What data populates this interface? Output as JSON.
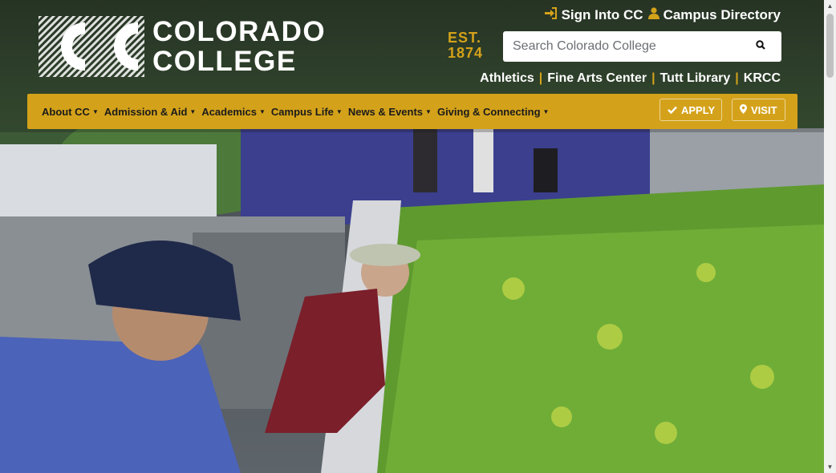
{
  "brand": {
    "name_line1": "COLORADO",
    "name_line2": "COLLEGE",
    "est_line1": "EST.",
    "est_line2": "1874"
  },
  "utility": {
    "sign_in": {
      "label": "Sign Into CC",
      "icon": "sign-in-icon"
    },
    "directory": {
      "label": "Campus Directory",
      "icon": "user-icon"
    }
  },
  "search": {
    "placeholder": "Search Colorado College",
    "value": "",
    "icon": "search-icon"
  },
  "quick_links": [
    "Athletics",
    "Fine Arts Center",
    "Tutt Library",
    "KRCC"
  ],
  "quick_links_separator": "|",
  "nav": {
    "items": [
      "About CC",
      "Admission & Aid",
      "Academics",
      "Campus Life",
      "News & Events",
      "Giving & Connecting"
    ],
    "apply_label": "APPLY",
    "visit_label": "VISIT"
  },
  "colors": {
    "gold": "#d4a21a",
    "nav_text": "#1a1a1a",
    "white": "#ffffff"
  },
  "hero": {
    "alt": "Workers tending a green roof garden"
  }
}
